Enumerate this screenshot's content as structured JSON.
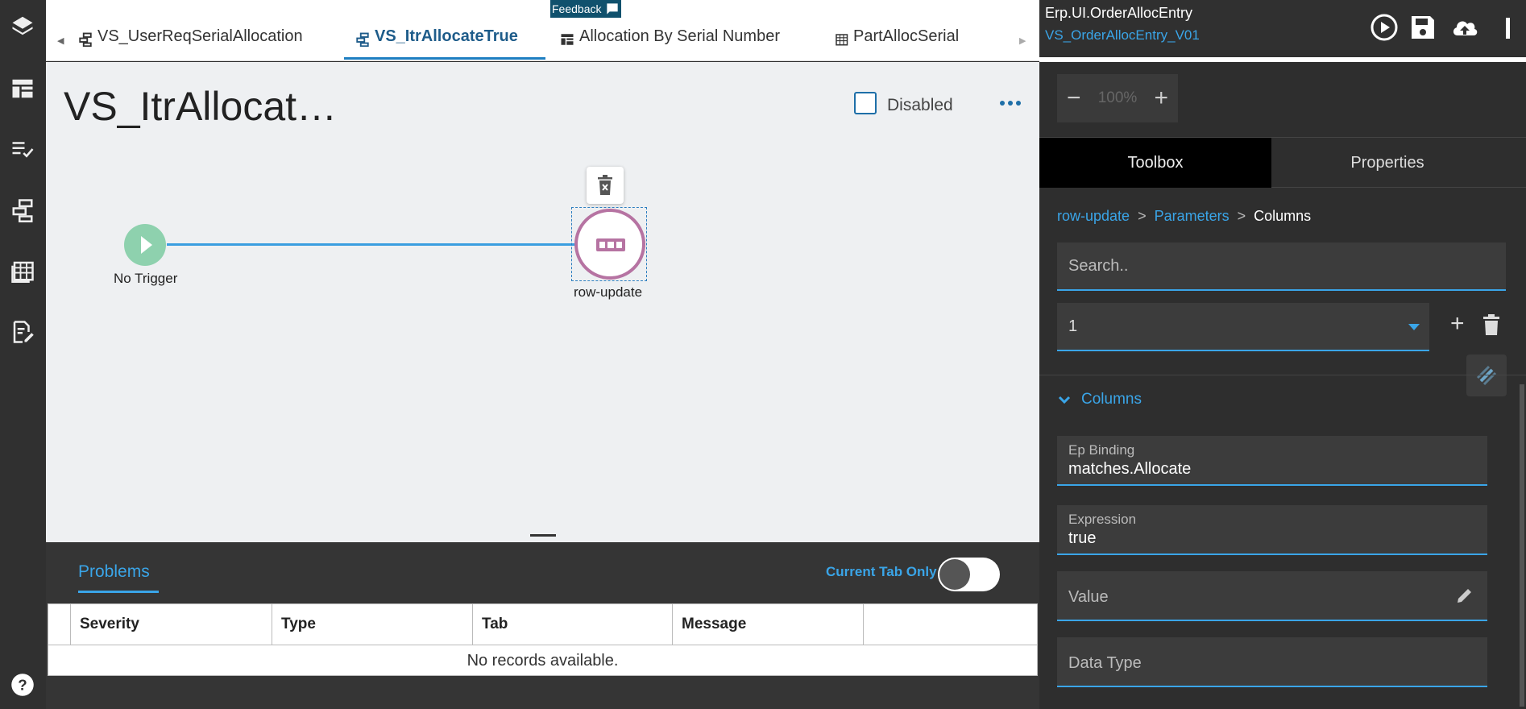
{
  "rail": {
    "icons": [
      "layers-icon",
      "layout-icon",
      "checklist-icon",
      "workflow-icon",
      "grid-icon",
      "document-edit-icon",
      "help-icon"
    ]
  },
  "tabs": [
    {
      "label": "VS_UserReqSerialAllocation",
      "icon": "workflow-icon",
      "active": false
    },
    {
      "label": "VS_ItrAllocateTrue",
      "icon": "workflow-icon",
      "active": true
    },
    {
      "label": "Allocation By Serial Number",
      "icon": "layout-icon",
      "active": false
    },
    {
      "label": "PartAllocSerial",
      "icon": "grid-icon",
      "active": false
    }
  ],
  "feedback": {
    "label": "Feedback"
  },
  "canvas": {
    "title": "VS_ItrAllocat…",
    "disabled_label": "Disabled",
    "trigger_label": "No Trigger",
    "node_label": "row-update"
  },
  "problems": {
    "tab_label": "Problems",
    "current_tab_only_label": "Current Tab Only",
    "columns": [
      "Severity",
      "Type",
      "Tab",
      "Message"
    ],
    "empty_text": "No records available."
  },
  "right_panel": {
    "app_name": "Erp.UI.OrderAllocEntry",
    "layer_name": "VS_OrderAllocEntry_V01",
    "zoom": {
      "minus": "−",
      "value": "100%",
      "plus": "+"
    },
    "tabs": {
      "toolbox": "Toolbox",
      "properties": "Properties"
    },
    "breadcrumb": {
      "item1": "row-update",
      "item2": "Parameters",
      "item3": "Columns",
      "sep": ">"
    },
    "search_placeholder": "Search..",
    "select_value": "1",
    "add_label": "+",
    "section_label": "Columns",
    "fields": {
      "ep_binding_label": "Ep Binding",
      "ep_binding_value": "matches.Allocate",
      "expression_label": "Expression",
      "expression_value": "true",
      "value_label": "Value",
      "data_type_label": "Data Type"
    }
  }
}
